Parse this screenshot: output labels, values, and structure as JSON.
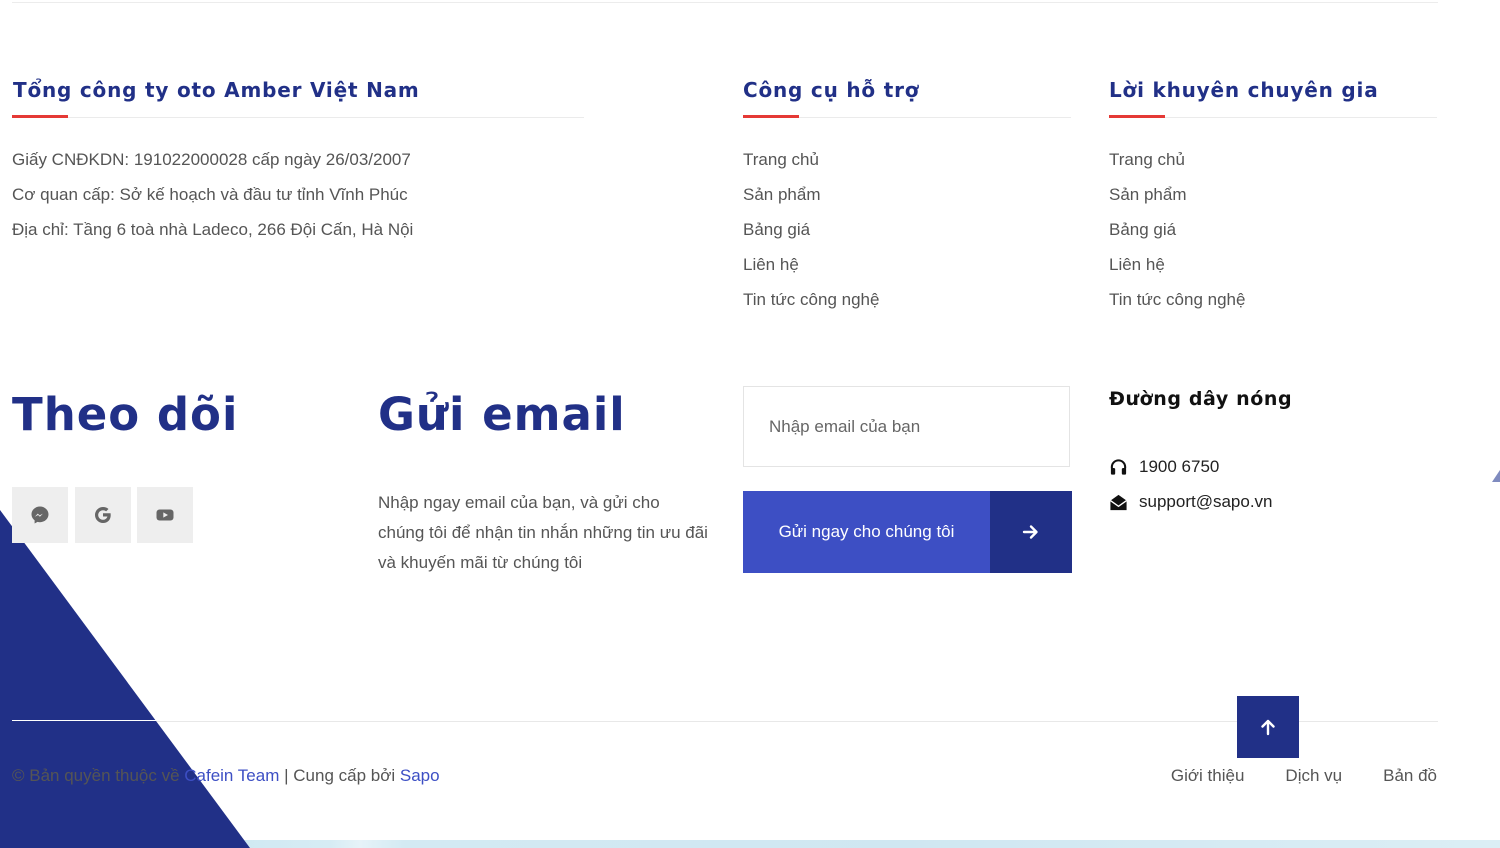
{
  "company": {
    "title": "Tổng công ty oto Amber Việt Nam",
    "lines": [
      "Giấy CNĐKDN: 191022000028 cấp ngày 26/03/2007",
      "Cơ quan cấp: Sở kế hoạch và đầu tư tỉnh Vĩnh Phúc",
      "Địa chỉ: Tầng 6 toà nhà Ladeco, 266 Đội Cấn, Hà Nội"
    ]
  },
  "tools": {
    "title": "Công cụ hỗ trợ",
    "items": [
      "Trang chủ",
      "Sản phẩm",
      "Bảng giá",
      "Liên hệ",
      "Tin tức công nghệ"
    ]
  },
  "advice": {
    "title": "Lời khuyên chuyên gia",
    "items": [
      "Trang chủ",
      "Sản phẩm",
      "Bảng giá",
      "Liên hệ",
      "Tin tức công nghệ"
    ]
  },
  "follow": {
    "title": "Theo dõi",
    "icons": [
      "messenger-icon",
      "google-icon",
      "youtube-icon"
    ]
  },
  "newsletter": {
    "title": "Gửi email",
    "description": "Nhập ngay email của bạn, và gửi cho chúng tôi để nhận tin nhắn những tin ưu đãi và khuyến mãi từ chúng tôi",
    "placeholder": "Nhập email của bạn",
    "button_label": "Gửi ngay cho chúng tôi",
    "button_icon": "arrow-right-icon"
  },
  "hotline": {
    "title": "Đường dây nóng",
    "phone": "1900 6750",
    "phone_icon": "headset-icon",
    "email": "support@sapo.vn",
    "email_icon": "envelope-open-icon"
  },
  "footer": {
    "copyright_prefix": "© Bản quyền thuộc về ",
    "team_link": "Cafein Team",
    "separator": " | Cung cấp bởi ",
    "provider_link": "Sapo",
    "links": [
      "Giới thiệu",
      "Dịch vụ",
      "Bản đồ"
    ],
    "back_to_top_icon": "arrow-up-icon"
  },
  "colors": {
    "brand_navy": "#213087",
    "button_blue": "#3d4fc4",
    "accent_red": "#e53935",
    "text_gray": "#555555"
  }
}
